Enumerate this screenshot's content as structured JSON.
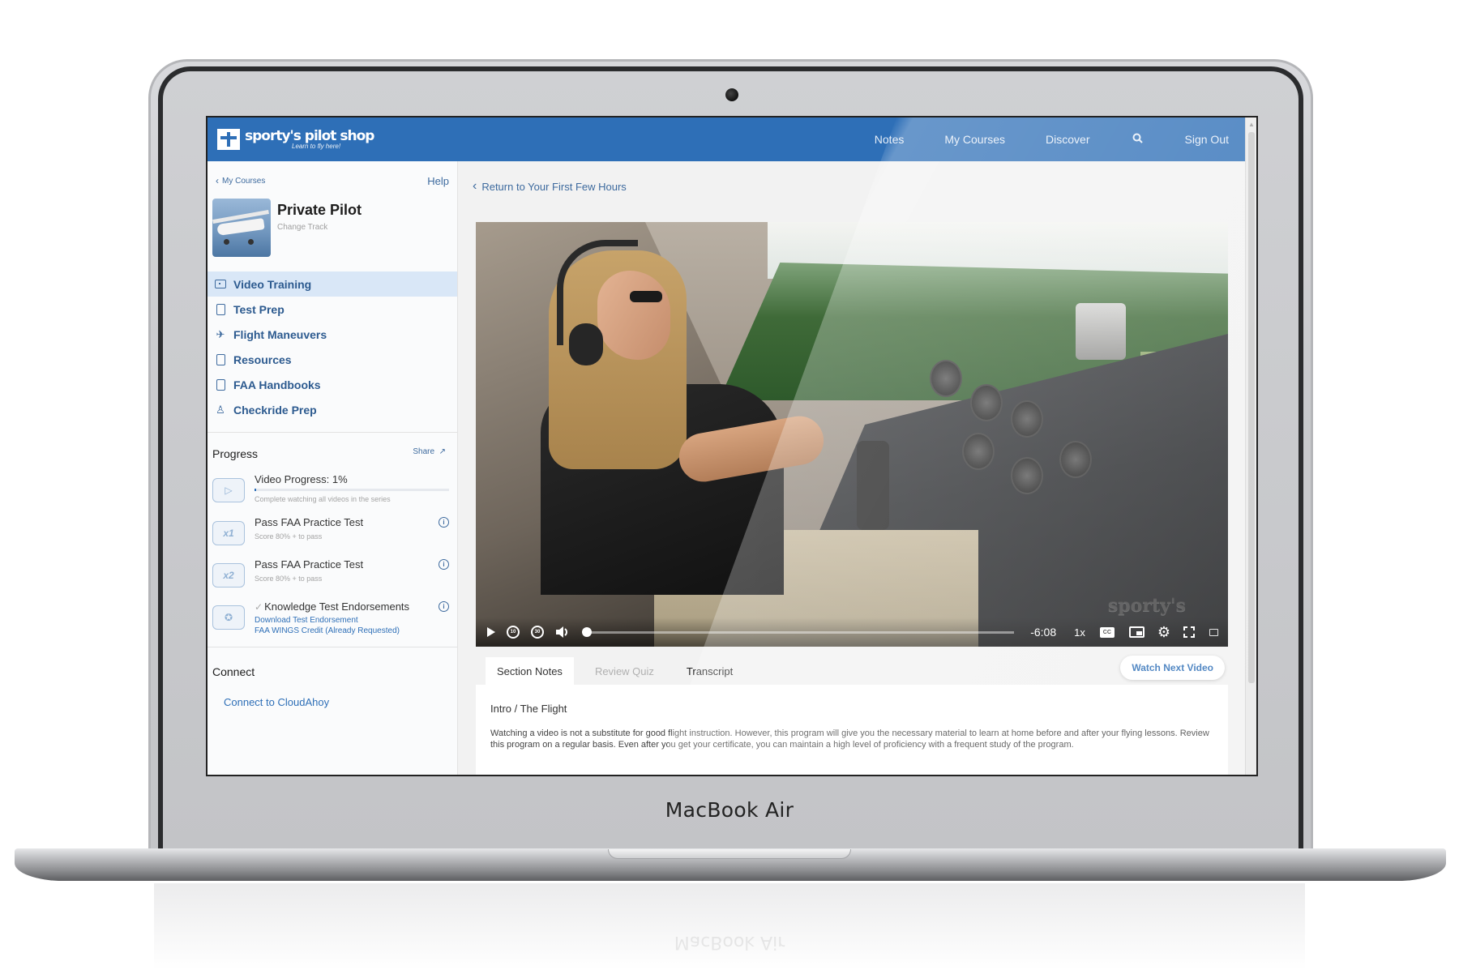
{
  "device": {
    "label": "MacBook Air"
  },
  "header": {
    "brand": "sporty's pilot shop",
    "tagline": "Learn to fly here!",
    "nav": [
      {
        "label": "Notes"
      },
      {
        "label": "My Courses"
      },
      {
        "label": "Discover"
      },
      {
        "label": "Sign Out"
      }
    ],
    "search_icon": "search-icon",
    "brand_color": "#2e6fb7"
  },
  "sidebar": {
    "back_label": "My Courses",
    "help_label": "Help",
    "course": {
      "title": "Private Pilot",
      "subtitle": "Change Track"
    },
    "menu": [
      {
        "label": "Video Training",
        "icon": "video-icon",
        "active": true
      },
      {
        "label": "Test Prep",
        "icon": "document-icon"
      },
      {
        "label": "Flight Maneuvers",
        "icon": "airplane-icon"
      },
      {
        "label": "Resources",
        "icon": "pdf-icon"
      },
      {
        "label": "FAA Handbooks",
        "icon": "pdf-icon"
      },
      {
        "label": "Checkride Prep",
        "icon": "pilot-icon"
      }
    ],
    "progress": {
      "title": "Progress",
      "share_label": "Share",
      "items": [
        {
          "label": "Video Progress: 1%",
          "sub": "Complete watching all videos in the series",
          "percent": 1
        },
        {
          "label": "Pass FAA Practice Test",
          "sub": "Score 80% + to pass",
          "badge": "x1"
        },
        {
          "label": "Pass FAA Practice Test",
          "sub": "Score 80% + to pass",
          "badge": "x2"
        },
        {
          "label": "Knowledge Test Endorsements",
          "links": [
            "Download Test Endorsement",
            "FAA WINGS Credit (Already Requested)"
          ]
        }
      ]
    },
    "connect": {
      "title": "Connect",
      "link": "Connect to CloudAhoy"
    }
  },
  "main": {
    "return_link": "Return to Your First Few Hours",
    "video": {
      "watermark": "sporty's",
      "time_remaining": "-6:08",
      "playback_rate": "1x",
      "cc_label": "CC",
      "progress_percent": 0.5
    },
    "tabs": [
      {
        "label": "Section Notes",
        "state": "active"
      },
      {
        "label": "Review Quiz",
        "state": "disabled"
      },
      {
        "label": "Transcript",
        "state": "normal"
      }
    ],
    "next_button": "Watch Next Video",
    "notes": {
      "title": "Intro / The Flight",
      "body": "Watching a video is not a substitute for good flight instruction. However, this program will give you the necessary material to learn at home before and after your flying lessons. Review this program on a regular basis. Even after you get your certificate, you can maintain a high level of proficiency with a frequent study of the program."
    }
  }
}
